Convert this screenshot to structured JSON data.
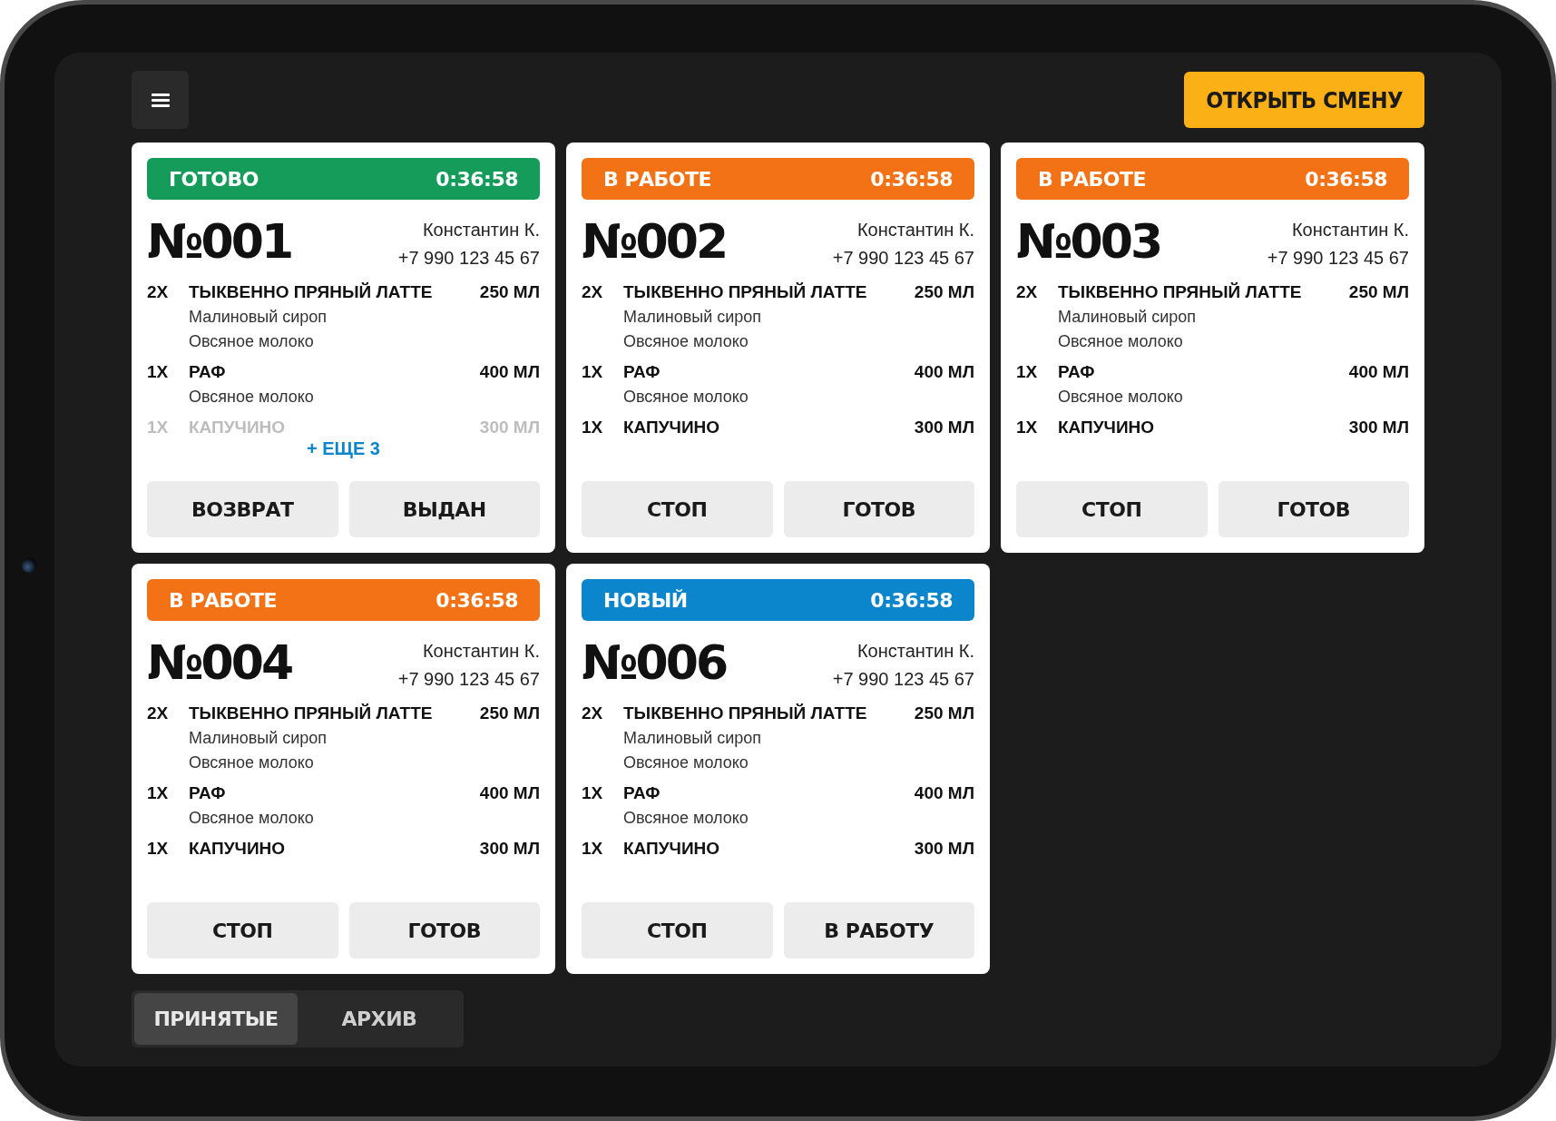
{
  "header": {
    "shift_button": "ОТКРЫТЬ СМЕНУ"
  },
  "orders": [
    {
      "status": "ГОТОВО",
      "color": "#169c5a",
      "timer": "0:36:58",
      "number": "№001",
      "customer": "Константин К.",
      "phone": "+7 990 123 45 67",
      "items": [
        {
          "qty": "2X",
          "name": "ТЫКВЕННО ПРЯНЫЙ ЛАТТЕ",
          "size": "250 МЛ",
          "options": [
            "Малиновый сироп",
            "Овсяное молоко"
          ],
          "faded": false
        },
        {
          "qty": "1X",
          "name": "РАФ",
          "size": "400 МЛ",
          "options": [
            "Овсяное молоко"
          ],
          "faded": false
        },
        {
          "qty": "1X",
          "name": "КАПУЧИНО",
          "size": "300 МЛ",
          "faded": true
        }
      ],
      "more": "+ ЕЩЕ 3",
      "buttons": [
        "ВОЗВРАТ",
        "ВЫДАН"
      ]
    },
    {
      "status": "В РАБОТЕ",
      "color": "#f47216",
      "timer": "0:36:58",
      "number": "№002",
      "customer": "Константин К.",
      "phone": "+7 990 123 45 67",
      "items": [
        {
          "qty": "2X",
          "name": "ТЫКВЕННО ПРЯНЫЙ ЛАТТЕ",
          "size": "250 МЛ",
          "options": [
            "Малиновый сироп",
            "Овсяное молоко"
          ],
          "faded": false
        },
        {
          "qty": "1X",
          "name": "РАФ",
          "size": "400 МЛ",
          "options": [
            "Овсяное молоко"
          ],
          "faded": false
        },
        {
          "qty": "1X",
          "name": "КАПУЧИНО",
          "size": "300 МЛ",
          "faded": false
        }
      ],
      "buttons": [
        "СТОП",
        "ГОТОВ"
      ]
    },
    {
      "status": "В РАБОТЕ",
      "color": "#f47216",
      "timer": "0:36:58",
      "number": "№003",
      "customer": "Константин К.",
      "phone": "+7 990 123 45 67",
      "items": [
        {
          "qty": "2X",
          "name": "ТЫКВЕННО ПРЯНЫЙ ЛАТТЕ",
          "size": "250 МЛ",
          "options": [
            "Малиновый сироп",
            "Овсяное молоко"
          ],
          "faded": false
        },
        {
          "qty": "1X",
          "name": "РАФ",
          "size": "400 МЛ",
          "options": [
            "Овсяное молоко"
          ],
          "faded": false
        },
        {
          "qty": "1X",
          "name": "КАПУЧИНО",
          "size": "300 МЛ",
          "faded": false
        }
      ],
      "buttons": [
        "СТОП",
        "ГОТОВ"
      ]
    },
    {
      "status": "В РАБОТЕ",
      "color": "#f47216",
      "timer": "0:36:58",
      "number": "№004",
      "customer": "Константин К.",
      "phone": "+7 990 123 45 67",
      "items": [
        {
          "qty": "2X",
          "name": "ТЫКВЕННО ПРЯНЫЙ ЛАТТЕ",
          "size": "250 МЛ",
          "options": [
            "Малиновый сироп",
            "Овсяное молоко"
          ],
          "faded": false
        },
        {
          "qty": "1X",
          "name": "РАФ",
          "size": "400 МЛ",
          "options": [
            "Овсяное молоко"
          ],
          "faded": false
        },
        {
          "qty": "1X",
          "name": "КАПУЧИНО",
          "size": "300 МЛ",
          "faded": false
        }
      ],
      "buttons": [
        "СТОП",
        "ГОТОВ"
      ]
    },
    {
      "status": "НОВЫЙ",
      "color": "#0b86cc",
      "timer": "0:36:58",
      "number": "№006",
      "customer": "Константин К.",
      "phone": "+7 990 123 45 67",
      "items": [
        {
          "qty": "2X",
          "name": "ТЫКВЕННО ПРЯНЫЙ ЛАТТЕ",
          "size": "250 МЛ",
          "options": [
            "Малиновый сироп",
            "Овсяное молоко"
          ],
          "faded": false
        },
        {
          "qty": "1X",
          "name": "РАФ",
          "size": "400 МЛ",
          "options": [
            "Овсяное молоко"
          ],
          "faded": false
        },
        {
          "qty": "1X",
          "name": "КАПУЧИНО",
          "size": "300 МЛ",
          "faded": false
        }
      ],
      "buttons": [
        "СТОП",
        "В РАБОТУ"
      ]
    }
  ],
  "tabs": [
    {
      "label": "ПРИНЯТЫЕ",
      "selected": true
    },
    {
      "label": "АРХИВ",
      "selected": false
    }
  ]
}
